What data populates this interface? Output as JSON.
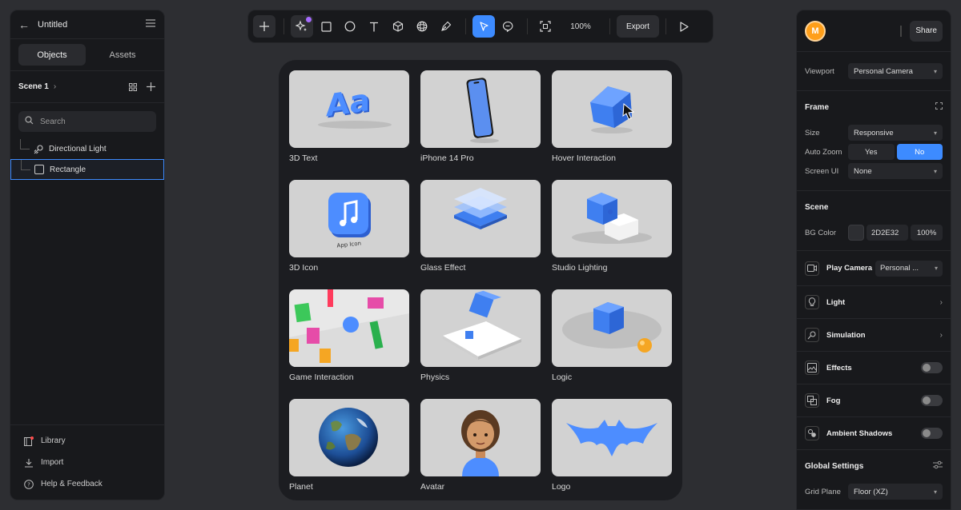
{
  "left_panel": {
    "title": "Untitled",
    "tabs": [
      {
        "label": "Objects"
      },
      {
        "label": "Assets"
      }
    ],
    "scene": {
      "name": "Scene 1"
    },
    "search_placeholder": "Search",
    "tree": [
      {
        "label": "Directional Light",
        "icon": "directional-light-icon"
      },
      {
        "label": "Rectangle",
        "icon": "rectangle-icon",
        "selected": true
      }
    ],
    "footer": [
      {
        "label": "Library",
        "icon": "library-icon"
      },
      {
        "label": "Import",
        "icon": "import-icon"
      },
      {
        "label": "Help & Feedback",
        "icon": "help-icon"
      }
    ]
  },
  "toolbar": {
    "zoom": "100%",
    "export_label": "Export",
    "tools": [
      "add-icon",
      "ai-sparkle-icon",
      "rectangle-tool-icon",
      "ellipse-tool-icon",
      "text-tool-icon",
      "cube-tool-icon",
      "sphere-tool-icon",
      "pen-tool-icon",
      "select-tool-icon",
      "comment-tool-icon",
      "frame-icon",
      "play-icon"
    ]
  },
  "gallery": {
    "items": [
      {
        "label": "3D Text",
        "thumb_text": "Aa"
      },
      {
        "label": "iPhone 14 Pro"
      },
      {
        "label": "Hover Interaction"
      },
      {
        "label": "3D Icon",
        "thumb_text": "App Icon"
      },
      {
        "label": "Glass Effect"
      },
      {
        "label": "Studio Lighting"
      },
      {
        "label": "Game Interaction"
      },
      {
        "label": "Physics"
      },
      {
        "label": "Logic"
      },
      {
        "label": "Planet"
      },
      {
        "label": "Avatar"
      },
      {
        "label": "Logo"
      }
    ]
  },
  "right_panel": {
    "avatar_initial": "M",
    "share_label": "Share",
    "viewport": {
      "label": "Viewport",
      "value": "Personal Camera"
    },
    "frame": {
      "title": "Frame",
      "size": {
        "label": "Size",
        "value": "Responsive"
      },
      "auto_zoom": {
        "label": "Auto Zoom",
        "yes": "Yes",
        "no": "No",
        "selected": "No"
      },
      "screen_ui": {
        "label": "Screen UI",
        "value": "None"
      }
    },
    "scene": {
      "title": "Scene",
      "bg_color": {
        "label": "BG Color",
        "hex": "2D2E32",
        "opacity": "100%",
        "swatch": "#2d2e32"
      }
    },
    "play_camera": {
      "label": "Play Camera",
      "value": "Personal ..."
    },
    "features": [
      {
        "label": "Light",
        "icon": "lightbulb-icon",
        "control": "arrow"
      },
      {
        "label": "Simulation",
        "icon": "simulation-icon",
        "control": "arrow"
      },
      {
        "label": "Effects",
        "icon": "effects-icon",
        "control": "toggle",
        "on": false
      },
      {
        "label": "Fog",
        "icon": "fog-icon",
        "control": "toggle",
        "on": false
      },
      {
        "label": "Ambient Shadows",
        "icon": "ambient-shadows-icon",
        "control": "toggle",
        "on": false
      }
    ],
    "global_settings": {
      "title": "Global Settings",
      "grid_plane": {
        "label": "Grid Plane",
        "value": "Floor (XZ)"
      }
    }
  },
  "colors": {
    "accent": "#3d8bff",
    "panel": "#18191c",
    "canvas": "#2d2e32",
    "avatar": "#ff9f1a",
    "notification": "#a66bff"
  }
}
